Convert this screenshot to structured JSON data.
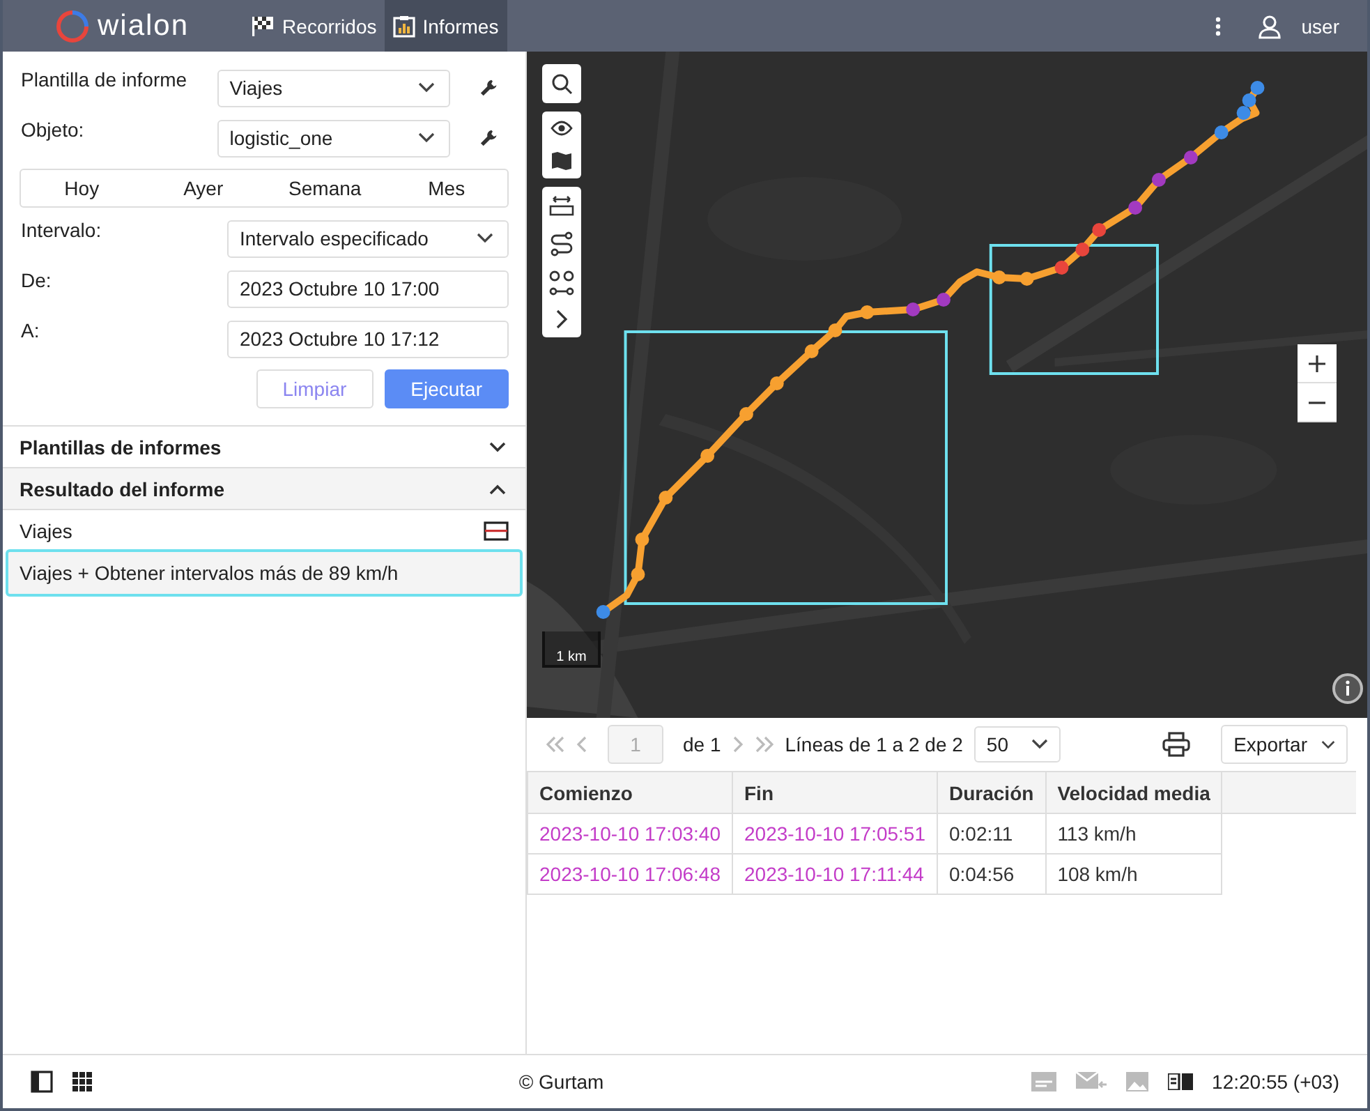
{
  "header": {
    "logo": "wialon",
    "tabs": [
      {
        "label": "Recorridos",
        "selected": false
      },
      {
        "label": "Informes",
        "selected": true
      }
    ],
    "user": "user"
  },
  "form": {
    "fields": [
      {
        "label": "Plantilla de informe",
        "kind": "select",
        "value": "Viajes",
        "wrench": true
      },
      {
        "label": "Objeto:",
        "kind": "select",
        "value": "logistic_one",
        "wrench": true
      },
      {
        "kind": "periods",
        "options": [
          {
            "label": "Hoy",
            "selected": false
          },
          {
            "label": "Ayer",
            "selected": false
          },
          {
            "label": "Semana",
            "selected": false
          },
          {
            "label": "Mes",
            "selected": false
          }
        ]
      },
      {
        "label": "Intervalo:",
        "kind": "select",
        "value": "Intervalo especificado",
        "wrench": false
      },
      {
        "label": "De:",
        "kind": "input",
        "value": "2023 Octubre 10 17:00",
        "wrench": false
      },
      {
        "label": "A:",
        "kind": "input",
        "value": "2023 Octubre 10 17:12",
        "wrench": false
      }
    ],
    "buttons": [
      {
        "label": "Limpiar",
        "kind": "secondary"
      },
      {
        "label": "Ejecutar",
        "kind": "primary"
      }
    ]
  },
  "sections": [
    {
      "title": "Plantillas de informes",
      "expanded": false
    },
    {
      "title": "Resultado del informe",
      "expanded": true
    }
  ],
  "results": {
    "group": "Viajes",
    "items": [
      {
        "label": "Viajes + Obtener intervalos más de 89 km/h",
        "selected": true
      }
    ]
  },
  "map": {
    "kind": "picture",
    "scale": "1 km"
  },
  "pager": {
    "page": "1",
    "of": "de 1",
    "lines": "Líneas de 1 a 2 de 2",
    "per_page": "50",
    "export": "Exportar"
  },
  "table": {
    "columns": [
      "Comienzo",
      "Fin",
      "Duración",
      "Velocidad media"
    ],
    "rows": [
      [
        "2023-10-10 17:03:40",
        "2023-10-10 17:05:51",
        "0:02:11",
        "113 km/h"
      ],
      [
        "2023-10-10 17:06:48",
        "2023-10-10 17:11:44",
        "0:04:56",
        "108 km/h"
      ]
    ]
  },
  "status_bar": {
    "copyright": "© Gurtam",
    "time": "12:20:55 (+03)"
  }
}
